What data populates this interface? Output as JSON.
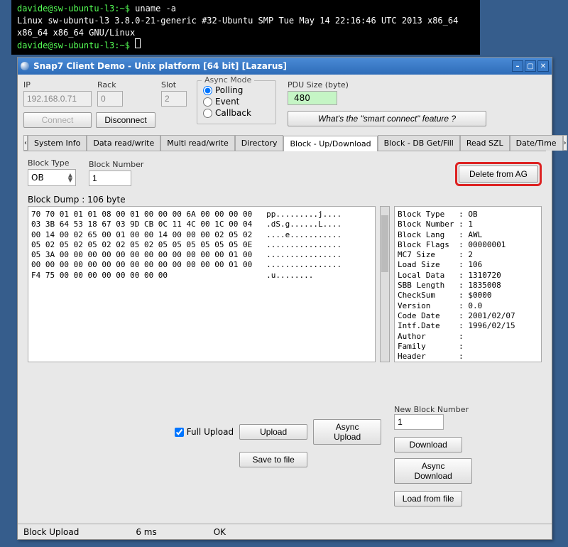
{
  "terminal": {
    "line1_prompt": "davide@sw-ubuntu-l3:~$ ",
    "line1_cmd": "uname -a",
    "line2": "Linux sw-ubuntu-l3 3.8.0-21-generic #32-Ubuntu SMP Tue May 14 22:16:46 UTC 2013 x86_64 x86_64 x86_64 GNU/Linux",
    "line3_prompt": "davide@sw-ubuntu-l3:~$ "
  },
  "window": {
    "title": "Snap7 Client Demo - Unix platform [64 bit] [Lazarus]"
  },
  "conn": {
    "ip_label": "IP",
    "ip_value": "192.168.0.71",
    "rack_label": "Rack",
    "rack_value": "0",
    "slot_label": "Slot",
    "slot_value": "2",
    "connect": "Connect",
    "disconnect": "Disconnect"
  },
  "async": {
    "legend": "Async Mode",
    "polling": "Polling",
    "event": "Event",
    "callback": "Callback"
  },
  "pdu": {
    "label": "PDU Size (byte)",
    "value": "480",
    "smart": "What's the \"smart connect\" feature ?"
  },
  "tabs": {
    "left_nav": "‹",
    "right_nav": "›",
    "items": [
      "System Info",
      "Data read/write",
      "Multi read/write",
      "Directory",
      "Block - Up/Download",
      "Block - DB Get/Fill",
      "Read SZL",
      "Date/Time"
    ],
    "active": "Block - Up/Download"
  },
  "block": {
    "type_label": "Block Type",
    "type_value": "OB",
    "num_label": "Block Number",
    "num_value": "1",
    "delete": "Delete from AG",
    "dump_label": "Block Dump : 106 byte",
    "hex": "70 70 01 01 01 08 00 01 00 00 00 6A 00 00 00 00   pp.........j....\n03 3B 64 53 18 67 03 9D CB 0C 11 4C 00 1C 00 04   .dS.g......L....\n00 14 00 02 65 00 01 00 00 14 00 00 00 02 05 02   ....e...........\n05 02 05 02 05 02 02 05 02 05 05 05 05 05 05 0E   ................\n05 3A 00 00 00 00 00 00 00 00 00 00 00 00 01 00   ................\n00 00 00 00 00 00 00 00 00 00 00 00 00 00 01 00   ................\nF4 75 00 00 00 00 00 00 00 00                     .u........",
    "info": "Block Type   : OB\nBlock Number : 1\nBlock Lang   : AWL\nBlock Flags  : 00000001\nMC7 Size     : 2\nLoad Size    : 106\nLocal Data   : 1310720\nSBB Length   : 1835008\nCheckSum     : $0000\nVersion      : 0.0\nCode Date    : 2001/02/07\nIntf.Date    : 1996/02/15\nAuthor       :\nFamily       :\nHeader       :",
    "full_upload": "Full Upload",
    "upload": "Upload",
    "async_upload": "Async Upload",
    "save": "Save to file",
    "new_num_label": "New Block Number",
    "new_num_value": "1",
    "download": "Download",
    "async_download": "Async Download",
    "load": "Load from file"
  },
  "status": {
    "op": "Block Upload",
    "time": "6 ms",
    "result": "OK"
  }
}
